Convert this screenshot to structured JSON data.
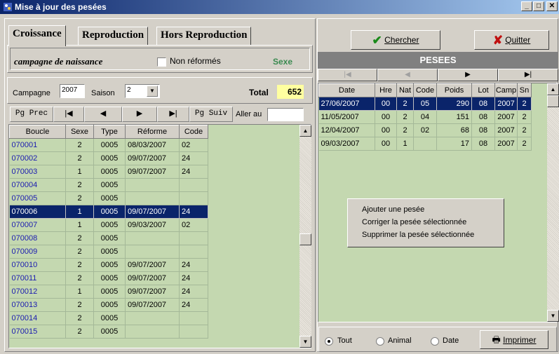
{
  "window": {
    "title": "Mise à jour des pesées",
    "min": "_",
    "max": "□",
    "close": "✕"
  },
  "tabs": [
    "Croissance",
    "Reproduction",
    "Hors Reproduction"
  ],
  "filter": {
    "campaign_label": "campagne de naissance",
    "non_reformes_label": "Non réformés",
    "sexe_label": "Sexe"
  },
  "campagne": {
    "label": "Campagne",
    "value": "2007",
    "saison_label": "Saison",
    "saison_value": "2",
    "total_label": "Total",
    "total_value": "652"
  },
  "pager": {
    "prev": "Pg Prec",
    "first": "|◀",
    "back": "◀",
    "next": "▶",
    "last": "▶|",
    "suiv": "Pg Suiv",
    "goto_label": "Aller au",
    "goto_value": ""
  },
  "animals": {
    "columns": [
      "Boucle",
      "Sexe",
      "Type",
      "Réforme",
      "Code"
    ],
    "rows": [
      [
        "070001",
        "2",
        "0005",
        "08/03/2007",
        "02"
      ],
      [
        "070002",
        "2",
        "0005",
        "09/07/2007",
        "24"
      ],
      [
        "070003",
        "1",
        "0005",
        "09/07/2007",
        "24"
      ],
      [
        "070004",
        "2",
        "0005",
        "",
        ""
      ],
      [
        "070005",
        "2",
        "0005",
        "",
        ""
      ],
      [
        "070006",
        "1",
        "0005",
        "09/07/2007",
        "24"
      ],
      [
        "070007",
        "1",
        "0005",
        "09/03/2007",
        "02"
      ],
      [
        "070008",
        "2",
        "0005",
        "",
        ""
      ],
      [
        "070009",
        "2",
        "0005",
        "",
        ""
      ],
      [
        "070010",
        "2",
        "0005",
        "09/07/2007",
        "24"
      ],
      [
        "070011",
        "2",
        "0005",
        "09/07/2007",
        "24"
      ],
      [
        "070012",
        "1",
        "0005",
        "09/07/2007",
        "24"
      ],
      [
        "070013",
        "2",
        "0005",
        "09/07/2007",
        "24"
      ],
      [
        "070014",
        "2",
        "0005",
        "",
        ""
      ],
      [
        "070015",
        "2",
        "0005",
        "",
        ""
      ]
    ],
    "selected_row": 5
  },
  "actions": {
    "search_label": "Chercher",
    "quit_label": "Quitter",
    "print_label": "Imprimer"
  },
  "pesees": {
    "title": "PESEES",
    "nav": [
      "|◀",
      "◀",
      "▶",
      "▶|"
    ],
    "columns": [
      "Date",
      "Hre",
      "Nat",
      "Code",
      "Poids",
      "Lot",
      "Camp",
      "Sn"
    ],
    "rows": [
      [
        "27/06/2007",
        "00",
        "2",
        "05",
        "290",
        "08",
        "2007",
        "2"
      ],
      [
        "11/05/2007",
        "00",
        "2",
        "04",
        "151",
        "08",
        "2007",
        "2"
      ],
      [
        "12/04/2007",
        "00",
        "2",
        "02",
        "68",
        "08",
        "2007",
        "2"
      ],
      [
        "09/03/2007",
        "00",
        "1",
        "",
        "17",
        "08",
        "2007",
        "2"
      ]
    ],
    "selected_row": 0
  },
  "context_menu": [
    "Ajouter une pesée",
    "Corriger la pesée sélectionnée",
    "Supprimer la pesée sélectionnée"
  ],
  "view_filter": {
    "options": [
      "Tout",
      "Animal",
      "Date"
    ],
    "selected": "Tout"
  },
  "colors": {
    "title_blue": "#0a246a",
    "grid_green": "#c4d8b0",
    "selection": "#0a246a",
    "total_bg": "#ffffa0",
    "sexe_green": "#3a8a50",
    "boucle_blue": "#1a1ab0"
  }
}
